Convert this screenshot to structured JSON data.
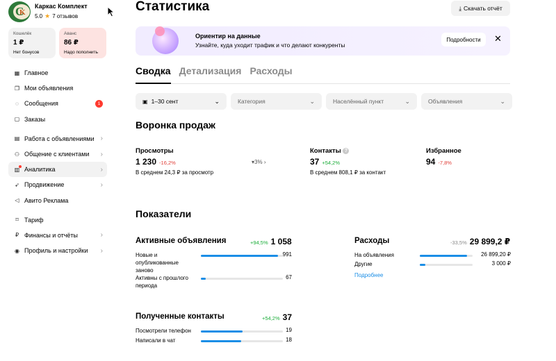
{
  "profile": {
    "name": "Каркас Комплект",
    "rating": "5.0",
    "reviews": "7 отзывов",
    "logo_text": "CK"
  },
  "wallet": {
    "label": "Кошелёк",
    "value": "1 ₽",
    "sub": "Нет бонусов"
  },
  "advance": {
    "label": "Аванс",
    "value": "86 ₽",
    "sub": "Надо пополнить"
  },
  "nav": {
    "main": "Главное",
    "listings": "Мои объявления",
    "messages": "Сообщения",
    "messages_badge": "1",
    "orders": "Заказы",
    "work_listings": "Работа с объявлениями",
    "clients": "Общение с клиентами",
    "analytics": "Аналитика",
    "promotion": "Продвижение",
    "ads": "Авито Реклама",
    "tariff": "Тариф",
    "finance": "Финансы и отчёты",
    "settings": "Профиль и настройки"
  },
  "header": {
    "title": "Статистика",
    "download": "Скачать отчёт"
  },
  "banner": {
    "title": "Ориентир на данные",
    "subtitle": "Узнайте, куда уходит трафик и что делают конкуренты",
    "button": "Подробности"
  },
  "tabs": [
    "Сводка",
    "Детализация",
    "Расходы"
  ],
  "filters": {
    "period": "1–30 сент",
    "category": "Категория",
    "location": "Населённый пункт",
    "listings": "Объявления"
  },
  "funnel": {
    "title": "Воронка продаж",
    "views": {
      "label": "Просмотры",
      "value": "1 230",
      "change": "-16,2%",
      "sub": "В среднем 24,3 ₽ за просмотр"
    },
    "conversion": "3%",
    "contacts": {
      "label": "Контакты",
      "value": "37",
      "change": "+54,2%",
      "sub": "В среднем 808,1 ₽ за контакт"
    },
    "favorites": {
      "label": "Избранное",
      "value": "94",
      "change": "-7,8%"
    }
  },
  "metrics": {
    "title": "Показатели",
    "active": {
      "title": "Активные объявления",
      "change": "+94,5%",
      "total": "1 058",
      "rows": [
        {
          "label": "Новые и опубликованные заново",
          "value": "991",
          "fraction": 0.94
        },
        {
          "label": "Активны с прошлого периода",
          "value": "67",
          "fraction": 0.06
        }
      ]
    },
    "expenses": {
      "title": "Расходы",
      "change": "-33,5%",
      "total": "29 899,2 ₽",
      "rows": [
        {
          "label": "На объявления",
          "value": "26 899,20 ₽",
          "fraction": 0.9
        },
        {
          "label": "Другие",
          "value": "3 000 ₽",
          "fraction": 0.1
        }
      ],
      "link": "Подробнее"
    },
    "contacts": {
      "title": "Полученные контакты",
      "change": "+54,2%",
      "total": "37",
      "rows": [
        {
          "label": "Посмотрели телефон",
          "value": "19",
          "fraction": 0.51
        },
        {
          "label": "Написали в чат",
          "value": "18",
          "fraction": 0.49
        }
      ]
    }
  },
  "colors": {
    "accent": "#1b8ee6",
    "negative": "#e0403a",
    "positive": "#1cad3a",
    "advance_bg": "#fde3e1"
  }
}
